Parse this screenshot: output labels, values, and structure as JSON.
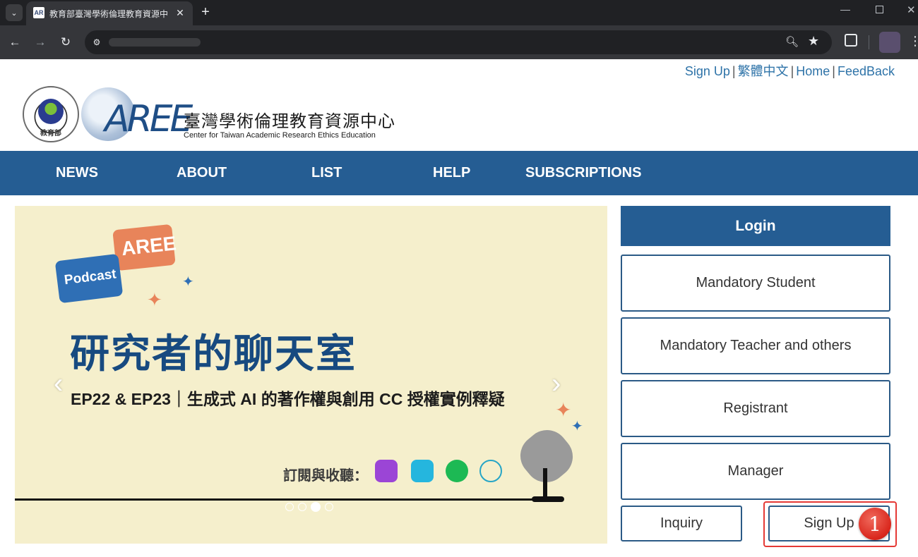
{
  "browser": {
    "tab_title": "教育部臺灣學術倫理教育資源中",
    "tab_favicon": "AR",
    "tab_close": "✕",
    "new_tab": "+",
    "menu_icon": "⌄",
    "back": "←",
    "forward": "→",
    "reload": "↻",
    "site_info": "⚙",
    "zoom": "🔍︎",
    "star": "★",
    "more": "⋮",
    "min": "—",
    "close": "✕"
  },
  "toplinks": [
    {
      "label": "Sign Up"
    },
    {
      "label": "繁體中文"
    },
    {
      "label": "Home"
    },
    {
      "label": "FeedBack"
    }
  ],
  "separator": "|",
  "logo": {
    "moe_text": "教育部",
    "aree": "AREE",
    "cn_name": "臺灣學術倫理教育資源中心",
    "en_name": "Center for Taiwan Academic Research Ethics Education"
  },
  "nav": [
    "NEWS",
    "ABOUT",
    "LIST",
    "HELP",
    "SUBSCRIPTIONS"
  ],
  "banner": {
    "bubble_podcast": "Podcast",
    "bubble_aree": "AREE",
    "title": "研究者的聊天室",
    "subtitle": "EP22 & EP23｜生成式 AI 的著作權與創用 CC 授權實例釋疑",
    "listen": "訂閱與收聽：",
    "prev": "‹",
    "next": "›",
    "slide_count": 4,
    "active_slide": 3
  },
  "login": {
    "title": "Login",
    "mandatory_student": "Mandatory Student",
    "mandatory_teacher": "Mandatory Teacher and others",
    "registrant": "Registrant",
    "manager": "Manager",
    "inquiry": "Inquiry",
    "signup": "Sign Up"
  },
  "annotation": {
    "step": "1"
  },
  "colors": {
    "brand_blue": "#255d93",
    "banner_bg": "#f5efcc",
    "highlight_red": "#e53935"
  }
}
